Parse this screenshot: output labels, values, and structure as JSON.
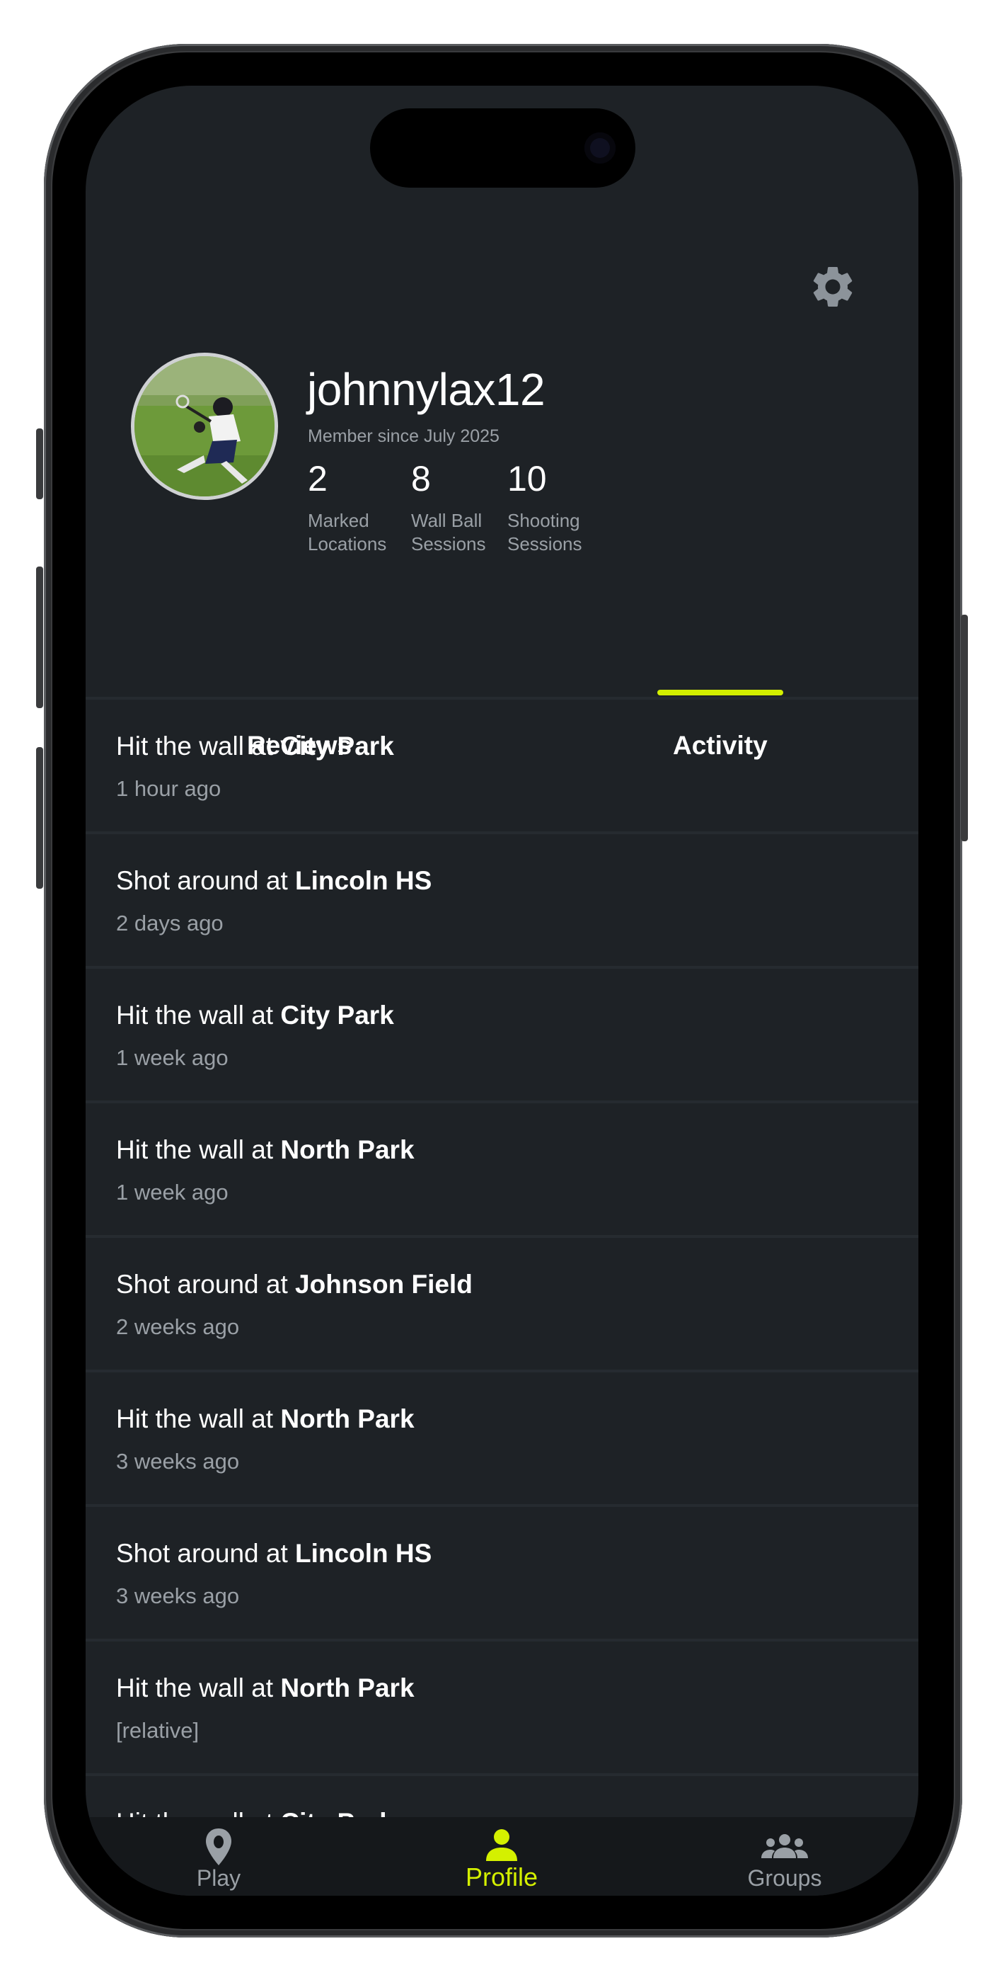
{
  "profile": {
    "username": "johnnylax12",
    "member_since": "Member since July 2025",
    "stats": [
      {
        "value": "2",
        "label_line1": "Marked",
        "label_line2": "Locations"
      },
      {
        "value": "8",
        "label_line1": "Wall Ball",
        "label_line2": "Sessions"
      },
      {
        "value": "10",
        "label_line1": "Shooting",
        "label_line2": "Sessions"
      }
    ],
    "settings_icon": "gear-icon",
    "avatar_icon": "avatar"
  },
  "tabs": [
    {
      "label": "Reviews",
      "active": false
    },
    {
      "label": "Activity",
      "active": true
    }
  ],
  "activity": [
    {
      "prefix": "Hit the wall at ",
      "place": "City Park",
      "time": "1 hour ago"
    },
    {
      "prefix": "Shot around at ",
      "place": "Lincoln HS",
      "time": "2 days ago"
    },
    {
      "prefix": "Hit the wall at ",
      "place": "City Park",
      "time": "1 week ago"
    },
    {
      "prefix": "Hit the wall at ",
      "place": "North Park",
      "time": "1 week ago"
    },
    {
      "prefix": "Shot around at ",
      "place": "Johnson Field",
      "time": "2 weeks ago"
    },
    {
      "prefix": "Hit the wall at ",
      "place": "North Park",
      "time": "3 weeks ago"
    },
    {
      "prefix": "Shot around at ",
      "place": "Lincoln HS",
      "time": "3 weeks ago"
    },
    {
      "prefix": "Hit the wall at ",
      "place": "North Park",
      "time": "[relative]"
    },
    {
      "prefix": "Hit the wall at ",
      "place": "City Park",
      "time": ""
    }
  ],
  "nav": [
    {
      "label": "Play",
      "icon": "map-pin-icon",
      "active": false
    },
    {
      "label": "Profile",
      "icon": "person-icon",
      "active": true
    },
    {
      "label": "Groups",
      "icon": "group-icon",
      "active": false
    }
  ],
  "colors": {
    "background": "#1e2226",
    "accent": "#d4f000",
    "text_primary": "#ffffff",
    "text_secondary": "#9aa0a6",
    "nav_background": "#15181b"
  }
}
